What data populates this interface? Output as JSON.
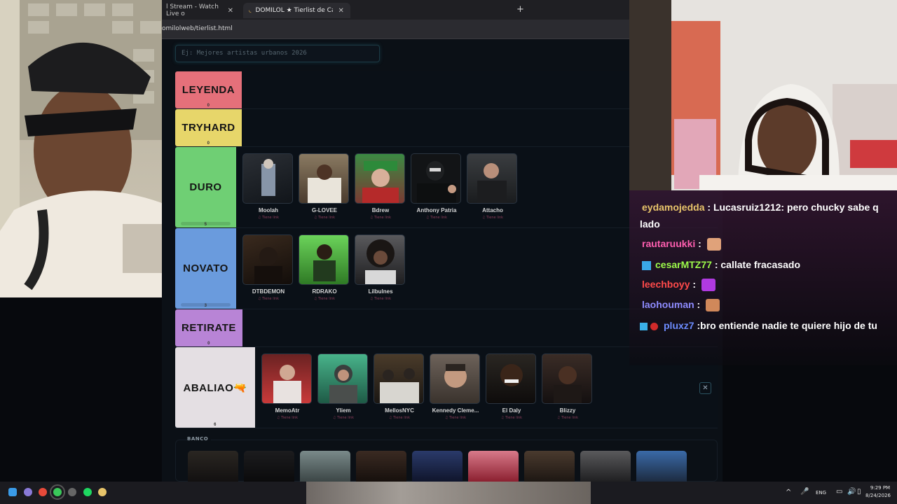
{
  "browser": {
    "tabs": [
      {
        "label": "l Stream - Watch Live o"
      },
      {
        "label": "DOMILOL ★ Tierlist de Cantant"
      }
    ],
    "url": "omilolweb/tierlist.html"
  },
  "page": {
    "title_placeholder": "Ej: Mejores artistas urbanos 2026",
    "bank_label": "BANCO"
  },
  "tiers": [
    {
      "label": "LEYENDA",
      "count": "0",
      "color": "#e5707a",
      "cards": []
    },
    {
      "label": "TRYHARD",
      "count": "0",
      "color": "#e7d66a",
      "cards": []
    },
    {
      "label": "DURO",
      "count": "5",
      "color": "#6fcf74",
      "cards": [
        {
          "name": "Moolah",
          "link": "Tiene link"
        },
        {
          "name": "G-LOVEE",
          "link": "Tiene link"
        },
        {
          "name": "Bdrew",
          "link": "Tiene link"
        },
        {
          "name": "Anthony Patria",
          "link": "Tiene link"
        },
        {
          "name": "Attacho",
          "link": "Tiene link"
        }
      ]
    },
    {
      "label": "NOVATO",
      "count": "3",
      "color": "#6a9bdd",
      "cards": [
        {
          "name": "DTBDEMON",
          "link": "Tiene link"
        },
        {
          "name": "RDRAKO",
          "link": "Tiene link"
        },
        {
          "name": "Lilbulnes",
          "link": "Tiene link"
        }
      ]
    },
    {
      "label": "RETIRATE",
      "count": "0",
      "color": "#b884d6",
      "cards": []
    },
    {
      "label": "ABALIAO🔫",
      "count": "6",
      "color": "#e4dfe3",
      "cards": [
        {
          "name": "MemoAtr",
          "link": "Tiene link"
        },
        {
          "name": "Yliem",
          "link": "Tiene link"
        },
        {
          "name": "MellosNYC",
          "link": "Tiene link"
        },
        {
          "name": "Kennedy Cleme...",
          "link": "Tiene link"
        },
        {
          "name": "El Daly",
          "link": "Tiene link"
        },
        {
          "name": "Blizzy",
          "link": "Tiene link"
        }
      ]
    }
  ],
  "chat": [
    {
      "user": "eydamojedda",
      "user_color": "#e8c46a",
      "text": "Lucasruiz1212: pero chucky sabe q",
      "cont": "lado"
    },
    {
      "user": "rautaruukki",
      "user_color": "#ff5fb0",
      "text": "",
      "emote": "face-emote"
    },
    {
      "user": "cesarMTZ77",
      "user_color": "#9dfc4a",
      "text": "callate fracasado",
      "badge": "prime-badge"
    },
    {
      "user": "leechboyy",
      "user_color": "#ff4a4a",
      "text": "",
      "emote": "purple-emote"
    },
    {
      "user": "laohouman",
      "user_color": "#8f8cff",
      "text": "",
      "emote": "face-emote"
    },
    {
      "user": "pluxz7",
      "user_color": "#6d8cff",
      "text": "bro entiende nadie te quiere hijo de tu",
      "badge": "cube-badge"
    }
  ],
  "taskbar": {
    "lang": "ENG",
    "time": "9:29 PM",
    "date": "8/24/2026"
  }
}
